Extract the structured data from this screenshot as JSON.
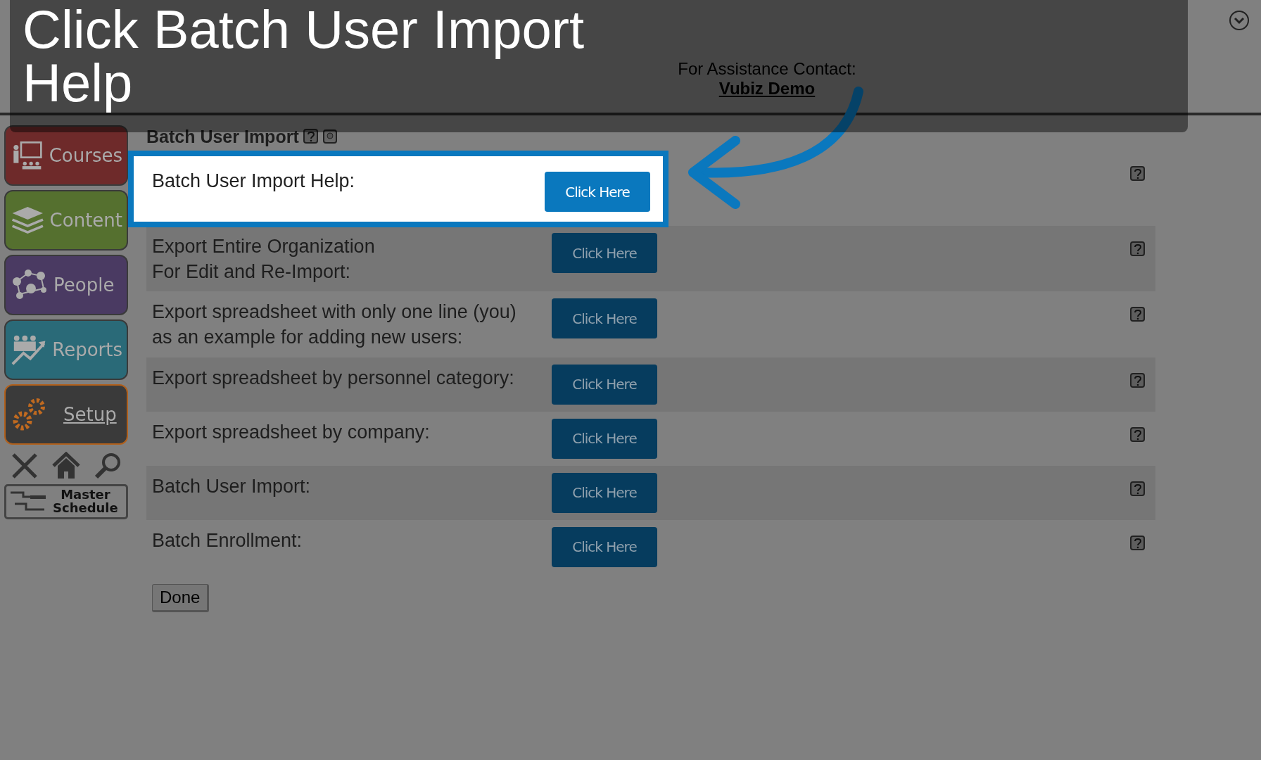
{
  "overlay": {
    "title": "Click Batch User Import Help"
  },
  "header": {
    "contact_label": "For Assistance Contact:",
    "contact_link": "Vubiz Demo"
  },
  "sidebar": {
    "items": [
      {
        "label": "Courses",
        "kind": "courses",
        "selected": false
      },
      {
        "label": "Content",
        "kind": "content",
        "selected": false
      },
      {
        "label": "People",
        "kind": "people",
        "selected": false
      },
      {
        "label": "Reports",
        "kind": "reports",
        "selected": false
      },
      {
        "label": "Setup",
        "kind": "setup",
        "selected": true
      }
    ],
    "master_schedule": [
      "Master",
      "Schedule"
    ]
  },
  "section": {
    "title": "Batch User Import",
    "rows": [
      {
        "lines": [
          "Batch User Import Help:"
        ],
        "button": "Click Here",
        "highlighted": true
      },
      {
        "lines": [
          "Export Entire Organization",
          "For Edit and Re-Import:"
        ],
        "button": "Click Here",
        "highlighted": false
      },
      {
        "lines": [
          "Export spreadsheet with only one line (you)",
          "as an example for adding new users:"
        ],
        "button": "Click Here",
        "highlighted": false
      },
      {
        "lines": [
          "Export spreadsheet by personnel category:"
        ],
        "button": "Click Here",
        "highlighted": false
      },
      {
        "lines": [
          "Export spreadsheet by company:"
        ],
        "button": "Click Here",
        "highlighted": false
      },
      {
        "lines": [
          "Batch User Import:"
        ],
        "button": "Click Here",
        "highlighted": false
      },
      {
        "lines": [
          "Batch Enrollment:"
        ],
        "button": "Click Here",
        "highlighted": false
      }
    ],
    "done": "Done"
  }
}
